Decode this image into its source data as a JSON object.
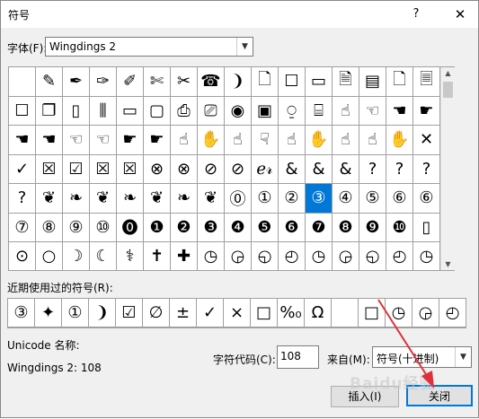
{
  "titlebar": {
    "title": "符号",
    "help": "?",
    "close": "✕"
  },
  "font": {
    "label": "字体(F):",
    "value": "Wingdings 2"
  },
  "grid_rows": [
    [
      "",
      "✎",
      "✒",
      "✑",
      "✐",
      "✄",
      "✂",
      "☎",
      "❩",
      "🗋",
      "☐",
      "▭",
      "🗎",
      "▤",
      "🗋",
      "🗏"
    ],
    [
      "☐",
      "❐",
      "▯",
      "⫼",
      "▭",
      "▢",
      "⎙",
      "⎚",
      "◉",
      "▣",
      "⍜",
      "⌸",
      "☝",
      "☜",
      "☚",
      "☛"
    ],
    [
      "☚",
      "☚",
      "☜",
      "☜",
      "☛",
      "☛",
      "☝",
      "✋",
      "☝",
      "☟",
      "☝",
      "✋",
      "☝",
      "☝",
      "✋",
      "✕"
    ],
    [
      "✓",
      "☒",
      "☑",
      "☒",
      "☒",
      "⊗",
      "⊗",
      "⊘",
      "⊘",
      "ℯ𝓇",
      "&",
      "&",
      "&",
      "?",
      "?",
      "?"
    ],
    [
      "?",
      "❦",
      "❧",
      "❦",
      "❧",
      "❦",
      "❧",
      "❦",
      "⓪",
      "①",
      "②",
      "③",
      "④",
      "⑤",
      "⑥",
      "⑥"
    ],
    [
      "⑦",
      "⑧",
      "⑨",
      "⑩",
      "⓿",
      "❶",
      "❷",
      "❸",
      "❹",
      "❺",
      "❻",
      "❼",
      "❽",
      "❾",
      "❿",
      "▯"
    ],
    [
      "⊙",
      "○",
      "☽",
      "☾",
      "⚕",
      "✝",
      "✚",
      "◷",
      "◶",
      "◵",
      "◴",
      "◷",
      "◶",
      "◵",
      "◴",
      "◷"
    ]
  ],
  "selected_symbol": "③",
  "recent": {
    "label": "近期使用过的符号(R):",
    "symbols": [
      "③",
      "✦",
      "①",
      "❩",
      "☑",
      "∅",
      "±",
      "✓",
      "×",
      "□",
      "%₀",
      "Ω",
      "",
      "□",
      "◷",
      "◶",
      "◴"
    ]
  },
  "unicode_name_label": "Unicode 名称:",
  "unicode_name_value": "Wingdings 2: 108",
  "char_code": {
    "label": "字符代码(C):",
    "value": "108"
  },
  "from": {
    "label": "来自(M):",
    "value": "符号(十进制)"
  },
  "buttons": {
    "insert": "插入(I)",
    "close": "关闭"
  },
  "watermark": "Baidu经验",
  "colors": {
    "selection": "#0078d7",
    "annotation_arrow": "#e0303a"
  }
}
